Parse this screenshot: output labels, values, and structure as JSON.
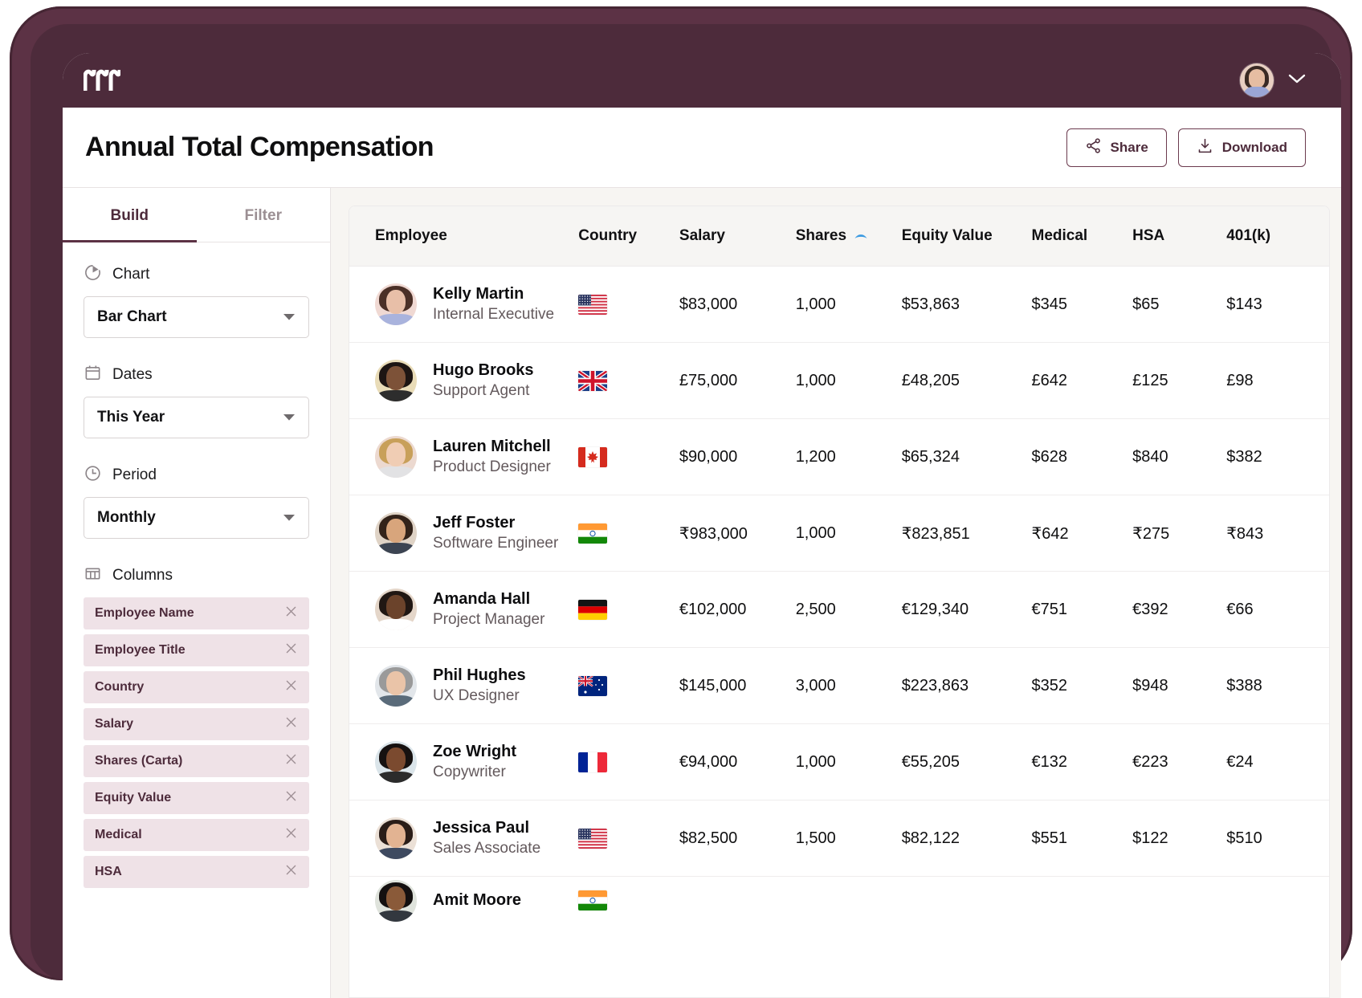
{
  "brand": {
    "logo_name": "rippling-logo"
  },
  "topbar": {
    "chevron": "chevron-down-icon"
  },
  "header": {
    "title": "Annual Total Compensation",
    "share_label": "Share",
    "download_label": "Download"
  },
  "sidebar": {
    "tabs": [
      {
        "label": "Build",
        "active": true
      },
      {
        "label": "Filter",
        "active": false
      }
    ],
    "chart": {
      "label": "Chart",
      "toggle_on": true,
      "select_value": "Bar Chart"
    },
    "dates": {
      "label": "Dates",
      "select_value": "This Year"
    },
    "period": {
      "label": "Period",
      "select_value": "Monthly"
    },
    "columns": {
      "label": "Columns",
      "chips": [
        "Employee Name",
        "Employee Title",
        "Country",
        "Salary",
        "Shares (Carta)",
        "Equity Value",
        "Medical",
        "HSA"
      ]
    }
  },
  "table": {
    "columns": [
      {
        "label": "Employee",
        "sorted": false
      },
      {
        "label": "Country",
        "sorted": false
      },
      {
        "label": "Salary",
        "sorted": false
      },
      {
        "label": "Shares",
        "sorted": true,
        "sort_direction": "asc",
        "sort_color": "#3b9ae1"
      },
      {
        "label": "Equity Value",
        "sorted": false
      },
      {
        "label": "Medical",
        "sorted": false
      },
      {
        "label": "HSA",
        "sorted": false
      },
      {
        "label": "401(k)",
        "sorted": false
      }
    ],
    "rows": [
      {
        "name": "Kelly Martin",
        "title": "Internal Executive",
        "country": "us",
        "salary": "$83,000",
        "shares": "1,000",
        "equity": "$53,863",
        "medical": "$345",
        "hsa": "$65",
        "k401": "$143"
      },
      {
        "name": "Hugo Brooks",
        "title": "Support Agent",
        "country": "gb",
        "salary": "£75,000",
        "shares": "1,000",
        "equity": "£48,205",
        "medical": "£642",
        "hsa": "£125",
        "k401": "£98"
      },
      {
        "name": "Lauren Mitchell",
        "title": "Product Designer",
        "country": "ca",
        "salary": "$90,000",
        "shares": "1,200",
        "equity": "$65,324",
        "medical": "$628",
        "hsa": "$840",
        "k401": "$382"
      },
      {
        "name": "Jeff Foster",
        "title": "Software Engineer",
        "country": "in",
        "salary": "₹983,000",
        "shares": "1,000",
        "equity": "₹823,851",
        "medical": "₹642",
        "hsa": "₹275",
        "k401": "₹843"
      },
      {
        "name": "Amanda Hall",
        "title": "Project Manager",
        "country": "de",
        "salary": "€102,000",
        "shares": "2,500",
        "equity": "€129,340",
        "medical": "€751",
        "hsa": "€392",
        "k401": "€66"
      },
      {
        "name": "Phil Hughes",
        "title": "UX Designer",
        "country": "au",
        "salary": "$145,000",
        "shares": "3,000",
        "equity": "$223,863",
        "medical": "$352",
        "hsa": "$948",
        "k401": "$388"
      },
      {
        "name": "Zoe Wright",
        "title": "Copywriter",
        "country": "fr",
        "salary": "€94,000",
        "shares": "1,000",
        "equity": "€55,205",
        "medical": "€132",
        "hsa": "€223",
        "k401": "€24"
      },
      {
        "name": "Jessica Paul",
        "title": "Sales Associate",
        "country": "us",
        "salary": "$82,500",
        "shares": "1,500",
        "equity": "$82,122",
        "medical": "$551",
        "hsa": "$122",
        "k401": "$510"
      },
      {
        "name": "Amit Moore",
        "title": "",
        "country": "in",
        "salary": "",
        "shares": "",
        "equity": "",
        "medical": "",
        "hsa": "",
        "k401": ""
      }
    ]
  },
  "colors": {
    "brand_maroon": "#4d2b3b",
    "chip_pink": "#efe2e7",
    "toggle_blue": "#3f6ad0",
    "sort_blue": "#3b9ae1",
    "canvas": "#f7f5f2"
  }
}
